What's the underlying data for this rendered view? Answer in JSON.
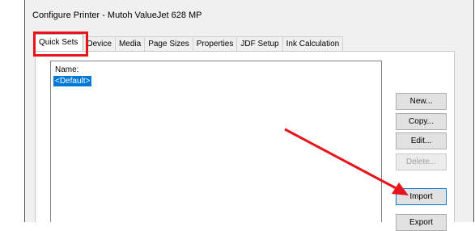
{
  "window": {
    "title": "Configure Printer - Mutoh ValueJet 628 MP"
  },
  "tabs": [
    {
      "label": "Quick Sets",
      "active": true
    },
    {
      "label": "Device",
      "active": false
    },
    {
      "label": "Media",
      "active": false
    },
    {
      "label": "Page Sizes",
      "active": false
    },
    {
      "label": "Properties",
      "active": false
    },
    {
      "label": "JDF Setup",
      "active": false
    },
    {
      "label": "Ink Calculation",
      "active": false
    }
  ],
  "quick_sets": {
    "list_label": "Name:",
    "items": [
      {
        "label": "<Default>",
        "selected": true
      }
    ]
  },
  "buttons": {
    "new_label": "New...",
    "copy_label": "Copy...",
    "edit_label": "Edit...",
    "delete_label": "Delete...",
    "import_label": "Import",
    "export_label": "Export"
  },
  "annotations": {
    "highlight_color": "#e8141b",
    "arrow_color": "#e8141b"
  }
}
